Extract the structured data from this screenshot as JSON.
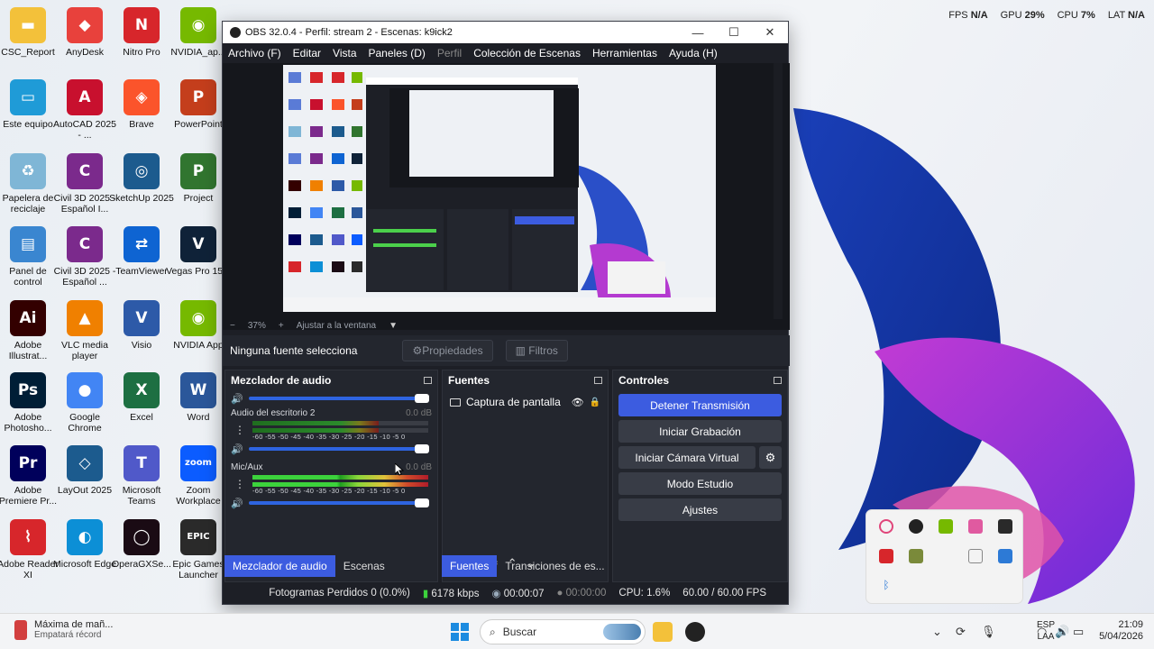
{
  "stats": {
    "fps_label": "FPS",
    "fps": "N/A",
    "gpu_label": "GPU",
    "gpu": "29%",
    "cpu_label": "CPU",
    "cpu": "7%",
    "lat_label": "LAT",
    "lat": "N/A"
  },
  "desktop_icons": [
    {
      "label": "CSC_Report",
      "color": "#f3c13a",
      "glyph": "▬"
    },
    {
      "label": "AnyDesk",
      "color": "#e8413c",
      "glyph": "◆"
    },
    {
      "label": "Nitro Pro",
      "color": "#d7262b",
      "glyph": "N"
    },
    {
      "label": "NVIDIA_ap...",
      "color": "#76b900",
      "glyph": "◉"
    },
    {
      "label": "Este equipo",
      "color": "#1f9bd7",
      "glyph": "▭"
    },
    {
      "label": "AutoCAD 2025 - ...",
      "color": "#c8102e",
      "glyph": "A"
    },
    {
      "label": "Brave",
      "color": "#fb542b",
      "glyph": "◈"
    },
    {
      "label": "PowerPoint",
      "color": "#c43e1c",
      "glyph": "P"
    },
    {
      "label": "Papelera de reciclaje",
      "color": "#7fb6d6",
      "glyph": "♻"
    },
    {
      "label": "Civil 3D 2025 - Español I...",
      "color": "#7b2a8c",
      "glyph": "C"
    },
    {
      "label": "SketchUp 2025",
      "color": "#1c5b8e",
      "glyph": "◎"
    },
    {
      "label": "Project",
      "color": "#31752f",
      "glyph": "P"
    },
    {
      "label": "Panel de control",
      "color": "#3a86d0",
      "glyph": "▤"
    },
    {
      "label": "Civil 3D 2025 - Español ...",
      "color": "#7b2a8c",
      "glyph": "C"
    },
    {
      "label": "TeamViewer",
      "color": "#0e64d2",
      "glyph": "⇄"
    },
    {
      "label": "Vegas Pro 15.0",
      "color": "#0f2238",
      "glyph": "V"
    },
    {
      "label": "Adobe Illustrat...",
      "color": "#330000",
      "glyph": "Ai"
    },
    {
      "label": "VLC media player",
      "color": "#f08000",
      "glyph": "▲"
    },
    {
      "label": "Visio",
      "color": "#2d5aa8",
      "glyph": "V"
    },
    {
      "label": "NVIDIA App",
      "color": "#76b900",
      "glyph": "◉"
    },
    {
      "label": "Adobe Photosho...",
      "color": "#001e36",
      "glyph": "Ps"
    },
    {
      "label": "Google Chrome",
      "color": "#4285f4",
      "glyph": "●"
    },
    {
      "label": "Excel",
      "color": "#1d6f42",
      "glyph": "X"
    },
    {
      "label": "Word",
      "color": "#2b579a",
      "glyph": "W"
    },
    {
      "label": "Adobe Premiere Pr...",
      "color": "#00005b",
      "glyph": "Pr"
    },
    {
      "label": "LayOut 2025",
      "color": "#1c5b8e",
      "glyph": "◇"
    },
    {
      "label": "Microsoft Teams",
      "color": "#5059c9",
      "glyph": "T"
    },
    {
      "label": "Zoom Workplace",
      "color": "#0b5cff",
      "glyph": "zoom"
    },
    {
      "label": "Adobe Reader XI",
      "color": "#d7262b",
      "glyph": "⌇"
    },
    {
      "label": "Microsoft Edge",
      "color": "#0c8fd6",
      "glyph": "◐"
    },
    {
      "label": "OperaGXSe...",
      "color": "#1a0b14",
      "glyph": "◯"
    },
    {
      "label": "Epic Games Launcher",
      "color": "#2a2a2a",
      "glyph": "EPIC"
    }
  ],
  "obs": {
    "title": "OBS 32.0.4 - Perfil: stream 2 - Escenas: k9ick2",
    "menu": [
      "Archivo (F)",
      "Editar",
      "Vista",
      "Paneles (D)",
      "Perfil",
      "Colección de Escenas",
      "Herramientas",
      "Ayuda (H)"
    ],
    "zoom": {
      "minus": "−",
      "value": "37%",
      "plus": "+",
      "fit": "Ajustar a la ventana"
    },
    "source_bar": {
      "none_selected": "Ninguna fuente selecciona",
      "properties": "Propiedades",
      "filters": "Filtros"
    },
    "mixer": {
      "title": "Mezclador de audio",
      "tracks": [
        {
          "name": "Audio del escritorio 2",
          "db": "0.0 dB"
        },
        {
          "name": "Mic/Aux",
          "db": "0.0 dB"
        }
      ],
      "scale": "-60 -55 -50 -45 -40 -35 -30 -25 -20 -15 -10  -5   0"
    },
    "sources": {
      "title": "Fuentes",
      "items": [
        "Captura de pantalla"
      ]
    },
    "controls": {
      "title": "Controles",
      "stop_stream": "Detener Transmisión",
      "start_recording": "Iniciar Grabación",
      "start_virtual_cam": "Iniciar Cámara Virtual",
      "studio_mode": "Modo Estudio",
      "settings": "Ajustes"
    },
    "tabs": {
      "mixer": "Mezclador de audio",
      "scenes": "Escenas",
      "sources": "Fuentes",
      "transitions": "Transiciones de es..."
    },
    "status": {
      "dropped": "Fotogramas Perdidos 0 (0.0%)",
      "bitrate": "6178 kbps",
      "stream_time": "00:00:07",
      "rec_time": "00:00:00",
      "cpu": "CPU: 1.6%",
      "fps": "60.00 / 60.00 FPS"
    }
  },
  "taskbar": {
    "weather_line1": "Máxima de mañ...",
    "weather_line2": "Empatará récord",
    "search": "Buscar",
    "lang1": "ESP",
    "lang2": "LAA",
    "time": "21:09",
    "date": "5/04/2026"
  }
}
